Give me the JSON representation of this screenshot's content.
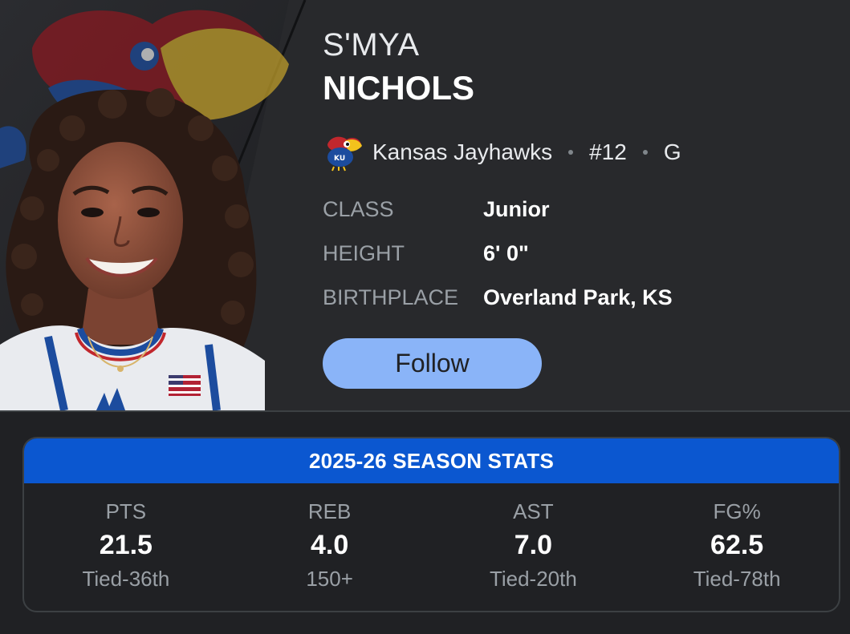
{
  "player": {
    "first_name": "S'MYA",
    "last_name": "NICHOLS",
    "team": "Kansas Jayhawks",
    "number": "#12",
    "position": "G"
  },
  "attributes": [
    {
      "label": "CLASS",
      "value": "Junior"
    },
    {
      "label": "HEIGHT",
      "value": "6' 0\""
    },
    {
      "label": "BIRTHPLACE",
      "value": "Overland Park, KS"
    }
  ],
  "follow_label": "Follow",
  "stats": {
    "title": "2025-26 SEASON STATS",
    "items": [
      {
        "label": "PTS",
        "value": "21.5",
        "rank": "Tied-36th"
      },
      {
        "label": "REB",
        "value": "4.0",
        "rank": "150+"
      },
      {
        "label": "AST",
        "value": "7.0",
        "rank": "Tied-20th"
      },
      {
        "label": "FG%",
        "value": "62.5",
        "rank": "Tied-78th"
      }
    ]
  },
  "colors": {
    "accent": "#0b57d0",
    "button": "#8ab4f8",
    "background": "#202124",
    "panel": "#28292c"
  },
  "icons": {
    "team_logo": "jayhawk-logo-icon",
    "headshot": "player-headshot"
  }
}
